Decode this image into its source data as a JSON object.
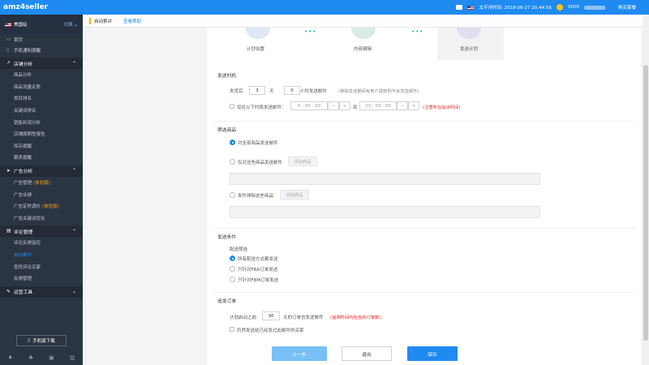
{
  "topbar": {
    "brand": "amz4seller",
    "time_label": "太平洋时间: 2018-06-27 20:44:56",
    "coins": "9000",
    "buy_label": "购买套餐"
  },
  "sidebar": {
    "site": "美国站",
    "switch": "切换",
    "items_top": [
      "首页",
      "手机通知提醒"
    ],
    "groups": [
      {
        "title": "店铺分析",
        "items": [
          {
            "label": "商品分析"
          },
          {
            "label": "商品流量走势"
          },
          {
            "label": "类目排名"
          },
          {
            "label": "关键词排名"
          },
          {
            "label": "销售利润分析"
          },
          {
            "label": "店铺周期性报告"
          },
          {
            "label": "库存提醒"
          },
          {
            "label": "跟卖提醒"
          }
        ]
      },
      {
        "title": "广告分析",
        "items": [
          {
            "label": "广告管理",
            "badge": "(体验版)"
          },
          {
            "label": "广告业绩"
          },
          {
            "label": "广告定时调价",
            "badge": "(体验版)"
          },
          {
            "label": "广告关键词优化"
          }
        ]
      },
      {
        "title": "评论管理",
        "items": [
          {
            "label": "评论反馈监控"
          },
          {
            "label": "自动索评",
            "active": true
          },
          {
            "label": "查找评论买家"
          },
          {
            "label": "反馈管理"
          }
        ]
      },
      {
        "title": "运营工具",
        "items": []
      }
    ],
    "mobile_download": "手机版下载"
  },
  "tabs": {
    "current": "自动索评",
    "help": "查看帮助"
  },
  "steps": [
    "计划设置",
    "内容编辑",
    "发送计划"
  ],
  "send_time": {
    "title": "发送时机",
    "delay_label": "发货后",
    "days_value": "3",
    "days_unit": "天",
    "hours_value": "0",
    "hours_unit": "小时发送邮件",
    "hint": "(移除发送期间有用户退款则不会发送邮件)",
    "only_label": "仅在以下时段发送邮件：",
    "from_value": "0 : 00 : 00",
    "to_label": "到",
    "to_value": "23 : 59 : 59",
    "only_warning": "(注意所在站点时间)"
  },
  "filter_products": {
    "title": "筛选商品",
    "opt_all": "对全部商品发送邮件",
    "opt_selected": "仅对这些商品发送邮件",
    "opt_exclude": "发件排除这些商品",
    "add_product": "添加商品"
  },
  "conditions": {
    "title": "发送条件",
    "delivery_label": "配送筛选",
    "opts": [
      "所有配送方式都发送",
      "只针对FBA订单发送",
      "只针对FBM订单发送"
    ]
  },
  "backfill": {
    "title": "追发订单",
    "before_label": "计划启动之前",
    "days_value": "30",
    "after_label": "天的订单也发送邮件",
    "warning": "(追溯时间内包含的订单数)",
    "exclude_label": "仍然发送给已经发过此邮件的买家"
  },
  "footer": {
    "prev": "上一步",
    "exit": "退出",
    "save": "保存"
  },
  "colors": {
    "primary": "#1f8bf0",
    "sidebar": "#2b3542",
    "warning": "#e02020",
    "beta": "#f0a020"
  }
}
